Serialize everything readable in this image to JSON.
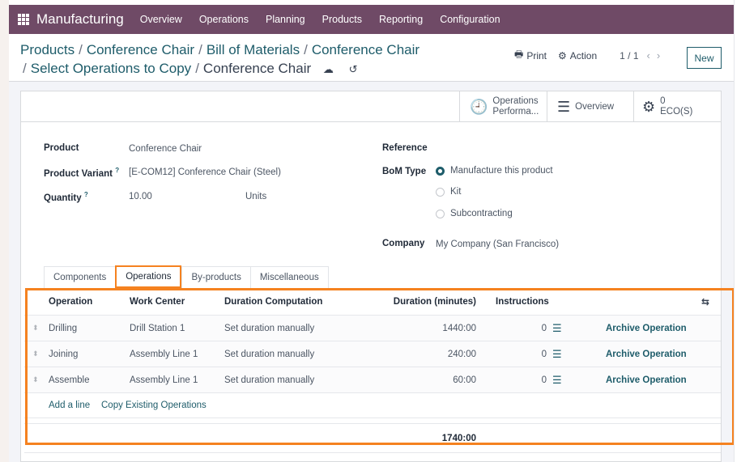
{
  "navbar": {
    "brand": "Manufacturing",
    "items": [
      "Overview",
      "Operations",
      "Planning",
      "Products",
      "Reporting",
      "Configuration"
    ]
  },
  "breadcrumb": {
    "items": [
      "Products",
      "Conference Chair",
      "Bill of Materials",
      "Conference Chair",
      "Select Operations to Copy"
    ],
    "current": "Conference Chair",
    "save_icon": "cloud-upload-icon",
    "discard_icon": "undo-icon"
  },
  "controls": {
    "print_label": "Print",
    "action_label": "Action",
    "pager": "1 / 1",
    "new_label": "New"
  },
  "stat_buttons": {
    "operations_performance": [
      "Operations",
      "Performa..."
    ],
    "overview": "Overview",
    "eco_count": "0",
    "eco_label": "ECO(S)"
  },
  "form": {
    "product_label": "Product",
    "product_value": "Conference Chair",
    "variant_label": "Product Variant",
    "variant_value": "[E-COM12] Conference Chair (Steel)",
    "quantity_label": "Quantity",
    "quantity_value": "10.00",
    "quantity_uom": "Units",
    "help_mark": "?",
    "reference_label": "Reference",
    "bom_type_label": "BoM Type",
    "bom_types": [
      {
        "label": "Manufacture this product",
        "selected": true
      },
      {
        "label": "Kit",
        "selected": false
      },
      {
        "label": "Subcontracting",
        "selected": false
      }
    ],
    "company_label": "Company",
    "company_value": "My Company (San Francisco)"
  },
  "tabs": [
    {
      "label": "Components",
      "active": false
    },
    {
      "label": "Operations",
      "active": true
    },
    {
      "label": "By-products",
      "active": false
    },
    {
      "label": "Miscellaneous",
      "active": false
    }
  ],
  "operations_table": {
    "headers": {
      "operation": "Operation",
      "work_center": "Work Center",
      "duration_computation": "Duration Computation",
      "duration": "Duration (minutes)",
      "instructions": "Instructions"
    },
    "rows": [
      {
        "operation": "Drilling",
        "work_center": "Drill Station 1",
        "duration_computation": "Set duration manually",
        "duration": "1440:00",
        "instructions": "0",
        "action": "Archive Operation"
      },
      {
        "operation": "Joining",
        "work_center": "Assembly Line 1",
        "duration_computation": "Set duration manually",
        "duration": "240:00",
        "instructions": "0",
        "action": "Archive Operation"
      },
      {
        "operation": "Assemble",
        "work_center": "Assembly Line 1",
        "duration_computation": "Set duration manually",
        "duration": "60:00",
        "instructions": "0",
        "action": "Archive Operation"
      }
    ],
    "add_line_label": "Add a line",
    "copy_existing_label": "Copy Existing Operations",
    "total_duration": "1740:00"
  },
  "colors": {
    "navbar": "#6f4a66",
    "link": "#1e5c6a",
    "highlight": "#f58220"
  }
}
